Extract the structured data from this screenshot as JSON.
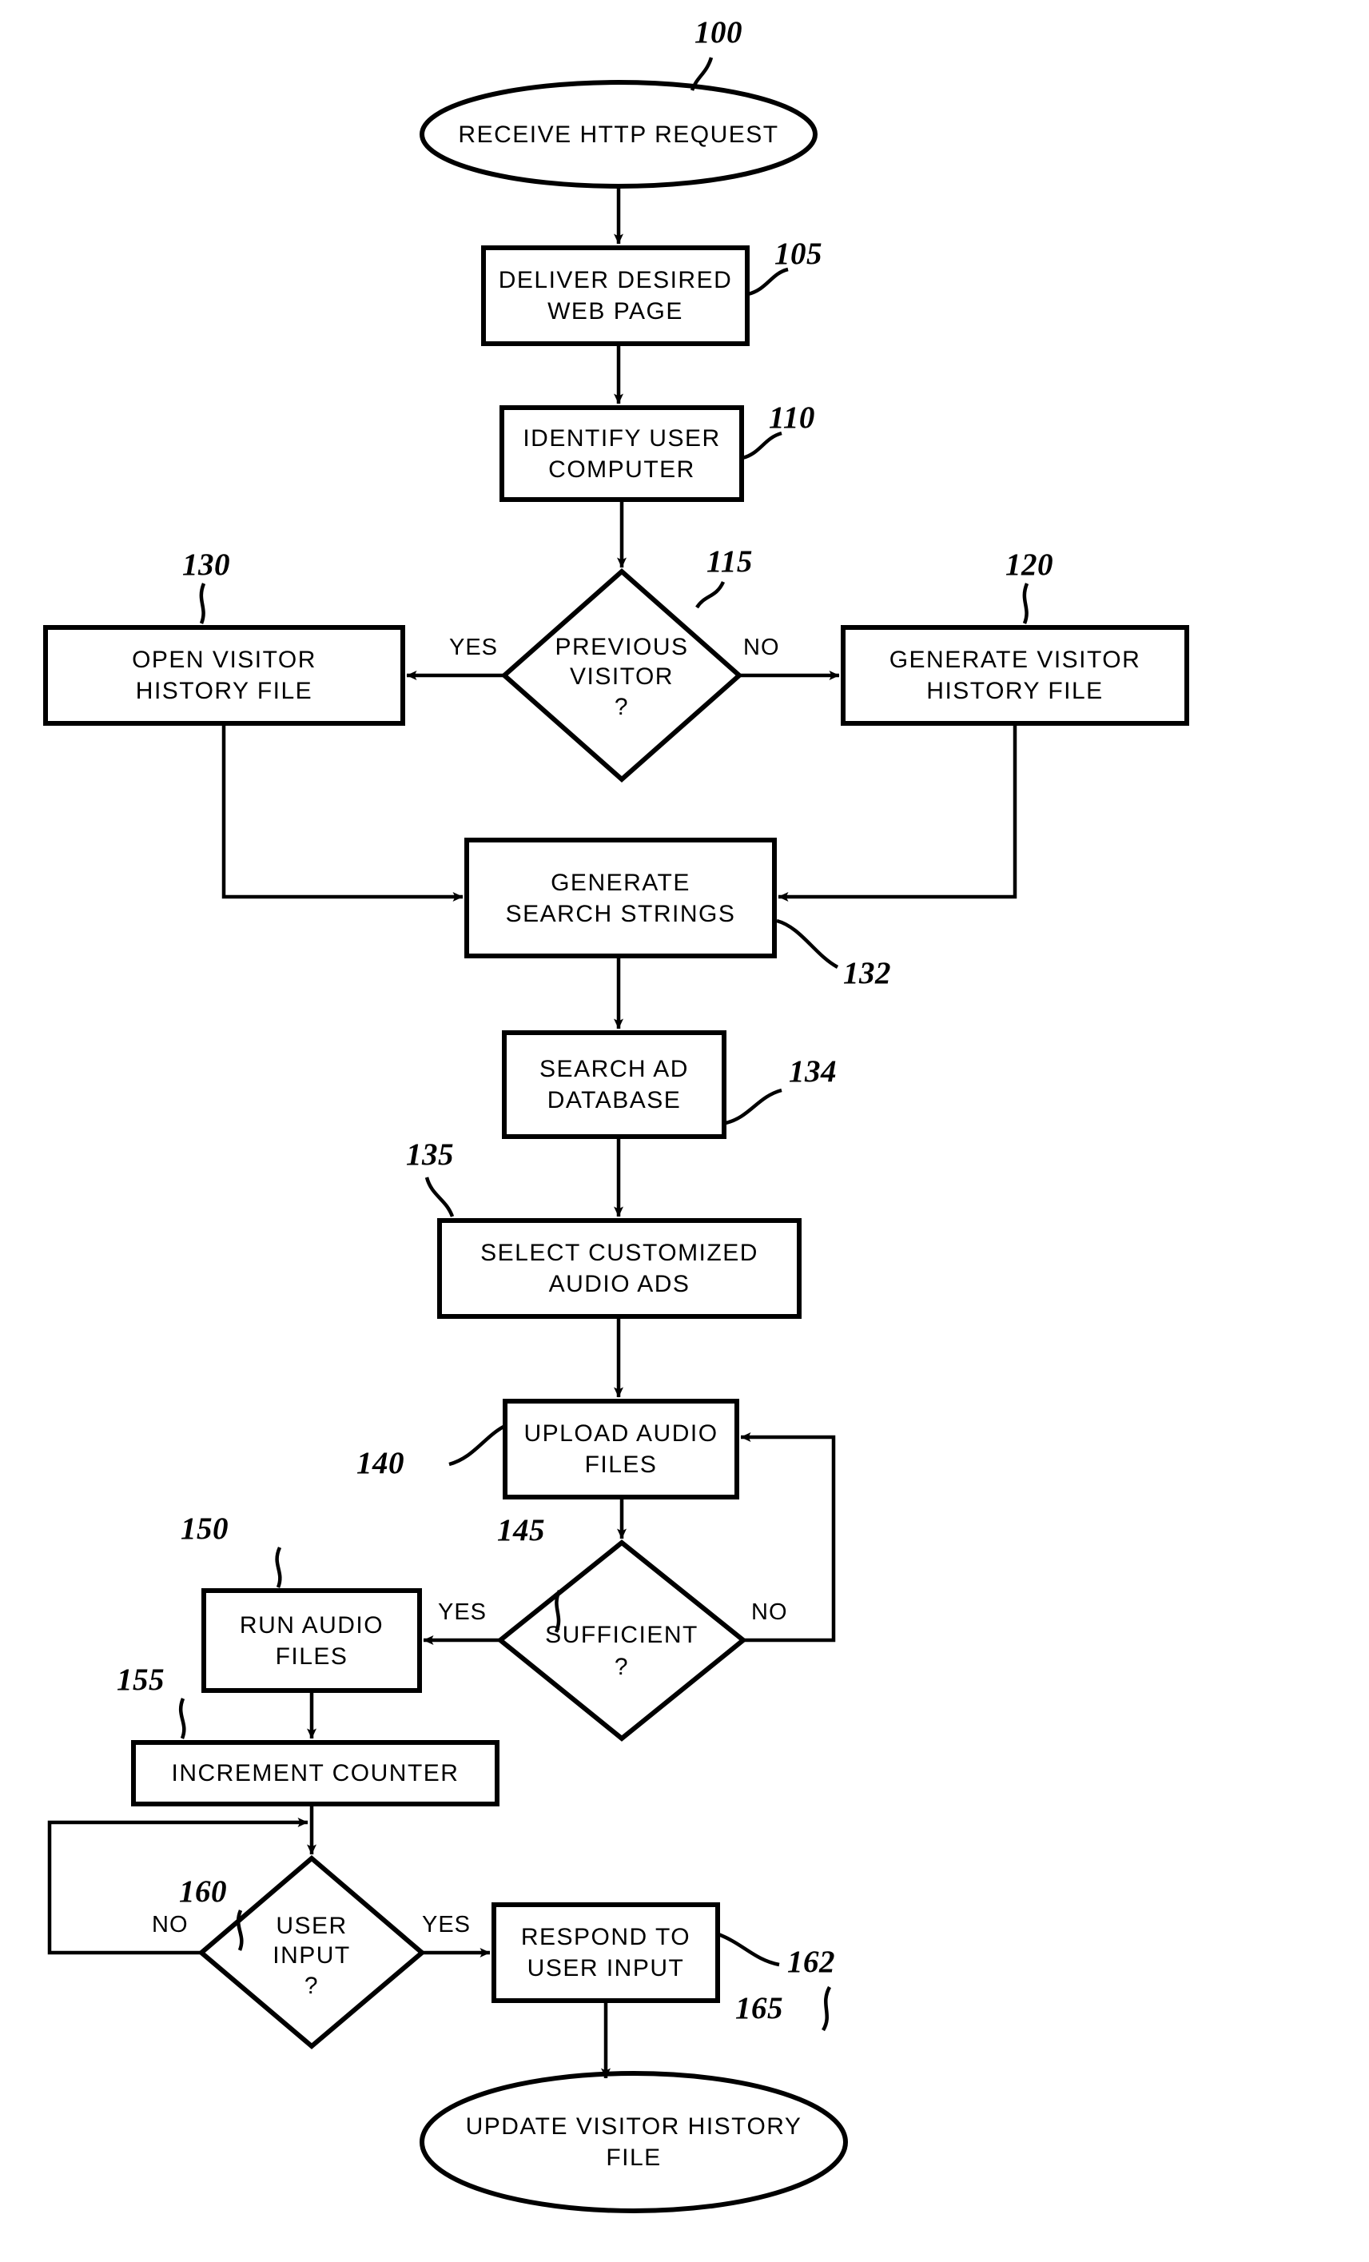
{
  "diagram": {
    "type": "flowchart",
    "title": "",
    "nodes": [
      {
        "id": "n100",
        "ref": "100",
        "shape": "oval",
        "text": "RECEIVE HTTP REQUEST"
      },
      {
        "id": "n105",
        "ref": "105",
        "shape": "rect",
        "text": "DELIVER DESIRED\nWEB PAGE"
      },
      {
        "id": "n110",
        "ref": "110",
        "shape": "rect",
        "text": "IDENTIFY USER\nCOMPUTER"
      },
      {
        "id": "n115",
        "ref": "115",
        "shape": "diamond",
        "text": "PREVIOUS\nVISITOR\n?"
      },
      {
        "id": "n130",
        "ref": "130",
        "shape": "rect",
        "text": "OPEN VISITOR\nHISTORY FILE"
      },
      {
        "id": "n120",
        "ref": "120",
        "shape": "rect",
        "text": "GENERATE VISITOR\nHISTORY FILE"
      },
      {
        "id": "n132",
        "ref": "132",
        "shape": "rect",
        "text": "GENERATE\nSEARCH STRINGS"
      },
      {
        "id": "n134",
        "ref": "134",
        "shape": "rect",
        "text": "SEARCH AD\nDATABASE"
      },
      {
        "id": "n135",
        "ref": "135",
        "shape": "rect",
        "text": "SELECT CUSTOMIZED\nAUDIO ADS"
      },
      {
        "id": "n140",
        "ref": "140",
        "shape": "rect",
        "text": "UPLOAD AUDIO\nFILES"
      },
      {
        "id": "n145",
        "ref": "145",
        "shape": "diamond",
        "text": "SUFFICIENT\n?"
      },
      {
        "id": "n150",
        "ref": "150",
        "shape": "rect",
        "text": "RUN AUDIO\nFILES"
      },
      {
        "id": "n155",
        "ref": "155",
        "shape": "rect",
        "text": "INCREMENT COUNTER"
      },
      {
        "id": "n160",
        "ref": "160",
        "shape": "diamond",
        "text": "USER\nINPUT\n?"
      },
      {
        "id": "n162",
        "ref": "162",
        "shape": "rect",
        "text": "RESPOND TO\nUSER INPUT"
      },
      {
        "id": "n165",
        "ref": "165",
        "shape": "oval",
        "text": "UPDATE VISITOR HISTORY\nFILE"
      }
    ],
    "edge_labels": {
      "yes_previous_visitor": "YES",
      "no_previous_visitor": "NO",
      "yes_sufficient": "YES",
      "no_sufficient": "NO",
      "yes_user_input": "YES",
      "no_user_input": "NO"
    },
    "edges": [
      {
        "from": "n100",
        "to": "n105",
        "label": ""
      },
      {
        "from": "n105",
        "to": "n110",
        "label": ""
      },
      {
        "from": "n110",
        "to": "n115",
        "label": ""
      },
      {
        "from": "n115",
        "to": "n130",
        "label": "YES"
      },
      {
        "from": "n115",
        "to": "n120",
        "label": "NO"
      },
      {
        "from": "n130",
        "to": "n132",
        "label": ""
      },
      {
        "from": "n120",
        "to": "n132",
        "label": ""
      },
      {
        "from": "n132",
        "to": "n134",
        "label": ""
      },
      {
        "from": "n134",
        "to": "n135",
        "label": ""
      },
      {
        "from": "n135",
        "to": "n140",
        "label": ""
      },
      {
        "from": "n140",
        "to": "n145",
        "label": ""
      },
      {
        "from": "n145",
        "to": "n150",
        "label": "YES"
      },
      {
        "from": "n145",
        "to": "n140",
        "label": "NO"
      },
      {
        "from": "n150",
        "to": "n155",
        "label": ""
      },
      {
        "from": "n155",
        "to": "n160",
        "label": ""
      },
      {
        "from": "n160",
        "to": "n162",
        "label": "YES"
      },
      {
        "from": "n160",
        "to": "n160",
        "label": "NO"
      },
      {
        "from": "n162",
        "to": "n165",
        "label": ""
      }
    ],
    "colors": {
      "stroke": "#000000",
      "fill": "#ffffff",
      "text": "#000000"
    }
  }
}
